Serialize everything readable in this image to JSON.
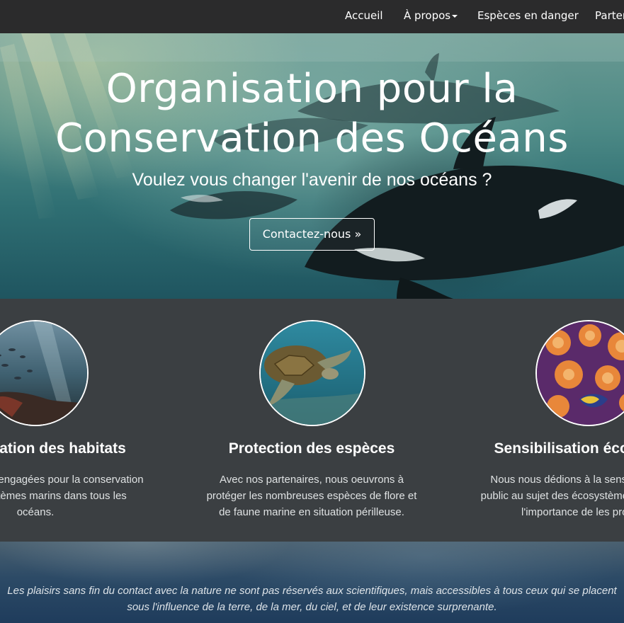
{
  "navbar": {
    "items": [
      {
        "label": "Accueil"
      },
      {
        "label": "À propos",
        "has_dropdown": true
      },
      {
        "label": "Espèces en danger"
      },
      {
        "label": "Partenaires"
      }
    ]
  },
  "hero": {
    "title_line1": "Organisation pour la",
    "title_line2": "Conservation des Océans",
    "subtitle": "Voulez vous changer l'avenir de nos océans ?",
    "cta_label": "Contactez-nous »"
  },
  "features": [
    {
      "title": "Préservation des habitats",
      "text": "Nous sommes engagées pour la conservation des écosystèmes marins dans tous les océans.",
      "image": "reef-fish-photo"
    },
    {
      "title": "Protection des espèces",
      "text": "Avec nos partenaires, nous oeuvrons à protéger les nombreuses espèces de flore et de faune marine en situation périlleuse.",
      "image": "sea-turtle-photo"
    },
    {
      "title": "Sensibilisation écologique",
      "text": "Nous nous dédions à la sensibilisation du public au sujet des écosystèmes marins et de l'importance de les protéger.",
      "image": "coral-anemone-photo"
    }
  ],
  "quote": {
    "text": "Les plaisirs sans fin du contact avec la nature ne sont pas réservés aux scientifiques, mais accessibles à tous ceux qui se placent sous l'influence de la terre, de la mer, du ciel, et de leur existence surprenante."
  },
  "colors": {
    "navbar_bg": "#2b2b2c",
    "features_bg": "#3b3f42",
    "text_primary": "#ffffff"
  }
}
